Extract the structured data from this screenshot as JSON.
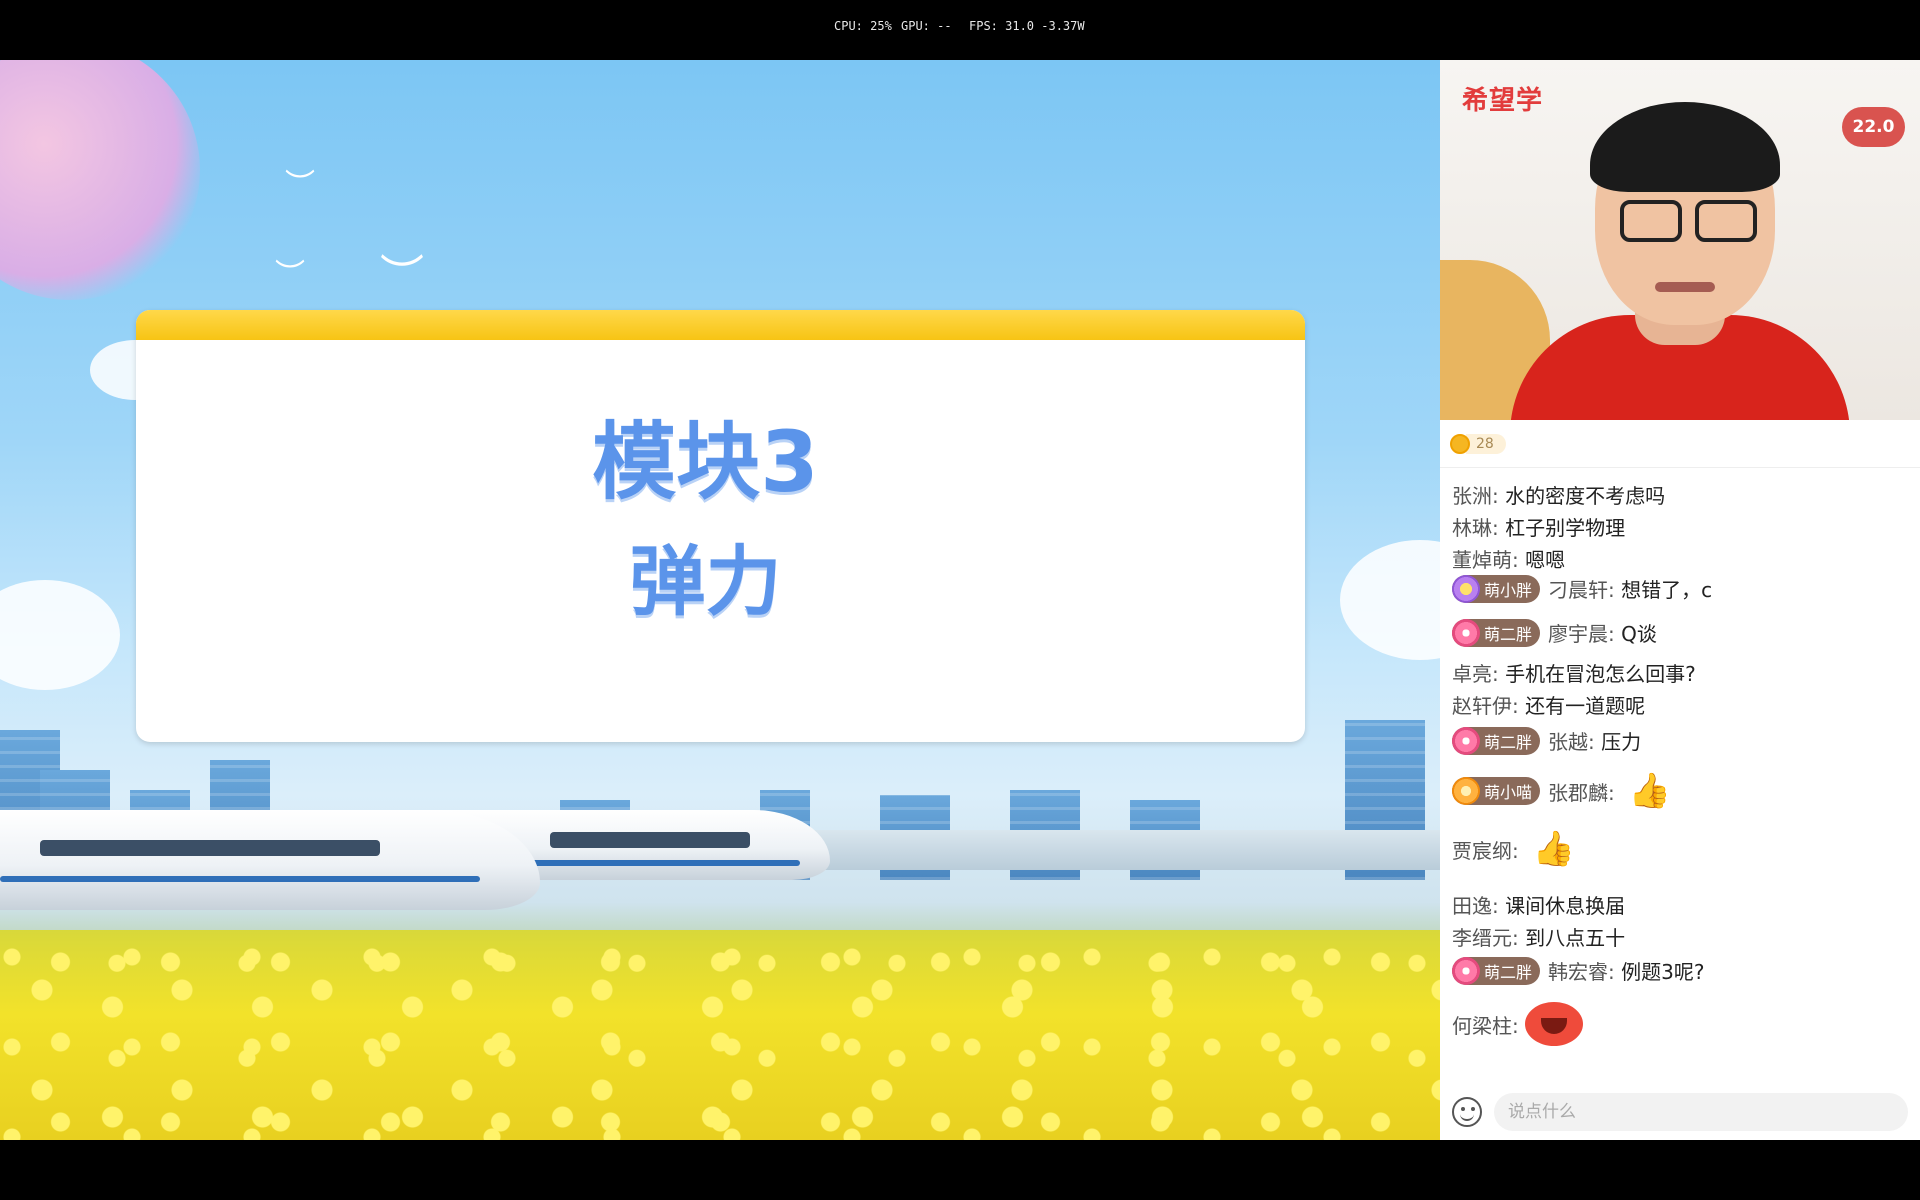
{
  "perf": {
    "cpu": "CPU: 25%",
    "gpu": "GPU: --",
    "fps": "FPS: 31.0  -3.37W"
  },
  "slide": {
    "title_line1": "模块3",
    "title_line2": "弹力"
  },
  "video": {
    "logo": "希望学",
    "badge": "22.0"
  },
  "stats": {
    "coin_count": "28"
  },
  "chat": {
    "messages": [
      {
        "name": "张洲:",
        "text": "水的密度不考虑吗"
      },
      {
        "name": "林琳:",
        "text": "杠子别学物理"
      },
      {
        "name": "董焯萌:",
        "text": "嗯嗯"
      },
      {
        "badge": "萌小胖",
        "name": "刁晨轩:",
        "text": "想错了，c"
      },
      {
        "badge": "萌二胖",
        "name": "廖宇晨:",
        "text": "Q谈"
      },
      {
        "name": "卓亮:",
        "text": "手机在冒泡怎么回事?"
      },
      {
        "name": "赵轩伊:",
        "text": "还有一道题呢"
      },
      {
        "badge": "萌二胖",
        "name": "张越:",
        "text": "压力"
      },
      {
        "badge": "萌小喵",
        "name": "张郡麟:",
        "emoji": "👍"
      },
      {
        "name": "贾宸纲:",
        "emoji": "👍"
      },
      {
        "name": "田逸:",
        "text": "课间休息换届"
      },
      {
        "name": "李缙元:",
        "text": "到八点五十"
      },
      {
        "badge": "萌二胖",
        "name": "韩宏睿:",
        "text": "例题3呢?"
      },
      {
        "name": "何梁柱:",
        "emoji": "laugh-emoji"
      }
    ],
    "input_placeholder": "说点什么"
  },
  "colors": {
    "title_blue": "#5b94ea",
    "logo_red": "#e23c3c",
    "badge_red": "#d9534f",
    "card_bar_yellow": "#f7c414"
  }
}
